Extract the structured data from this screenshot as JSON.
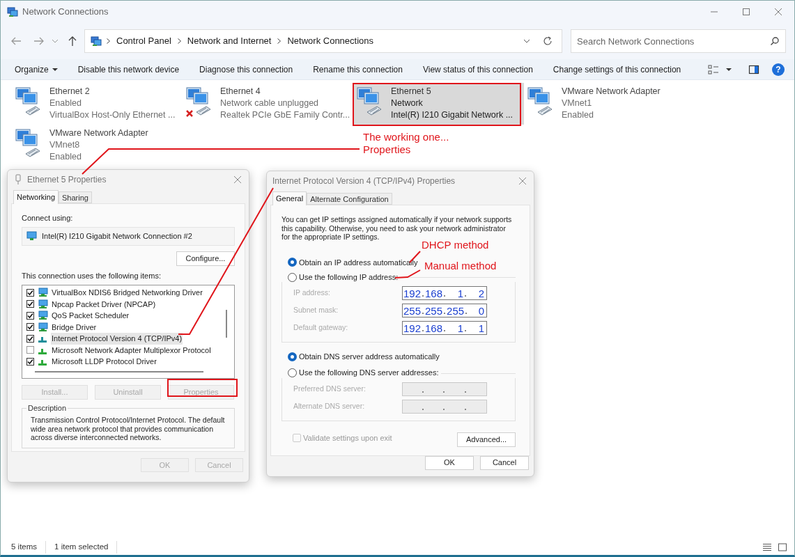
{
  "window": {
    "title": "Network Connections"
  },
  "address_bar": {
    "breadcrumbs": [
      "Control Panel",
      "Network and Internet",
      "Network Connections"
    ]
  },
  "search": {
    "placeholder": "Search Network Connections"
  },
  "command_bar": {
    "items": [
      {
        "label": "Organize",
        "kind": "menu"
      },
      {
        "label": "Disable this network device",
        "kind": "command"
      },
      {
        "label": "Diagnose this connection",
        "kind": "command"
      },
      {
        "label": "Rename this connection",
        "kind": "command"
      },
      {
        "label": "View status of this connection",
        "kind": "command"
      },
      {
        "label": "Change settings of this connection",
        "kind": "command"
      }
    ],
    "help_glyph": "?"
  },
  "adapters": [
    {
      "name": "Ethernet 2",
      "status": "Enabled",
      "device": "VirtualBox Host-Only Ethernet ...",
      "unplugged": false,
      "selected": false
    },
    {
      "name": "Ethernet 4",
      "status": "Network cable unplugged",
      "device": "Realtek PCIe GbE Family Contr...",
      "unplugged": true,
      "selected": false
    },
    {
      "name": "Ethernet 5",
      "status": "Network",
      "device": "Intel(R) I210 Gigabit Network ...",
      "unplugged": false,
      "selected": true
    },
    {
      "name": "VMware Network Adapter",
      "status": "VMnet1",
      "device": "Enabled",
      "unplugged": false,
      "selected": false
    },
    {
      "name": "VMware Network Adapter",
      "status": "VMnet8",
      "device": "Enabled",
      "unplugged": false,
      "selected": false
    }
  ],
  "status_bar": {
    "count": "5 items",
    "selection": "1 item selected"
  },
  "ethernet_dialog": {
    "title": "Ethernet 5 Properties",
    "tabs": [
      {
        "label": "Networking",
        "selected": true
      },
      {
        "label": "Sharing",
        "selected": false
      }
    ],
    "connect_using_label": "Connect using:",
    "device": "Intel(R) I210 Gigabit Network Connection #2",
    "configure_button": "Configure...",
    "items_label": "This connection uses the following items:",
    "items": [
      {
        "label": "VirtualBox NDIS6 Bridged Networking Driver",
        "kind": "service",
        "checked": true,
        "selected": false
      },
      {
        "label": "Npcap Packet Driver (NPCAP)",
        "kind": "service",
        "checked": true,
        "selected": false
      },
      {
        "label": "QoS Packet Scheduler",
        "kind": "service",
        "checked": true,
        "selected": false
      },
      {
        "label": "Bridge Driver",
        "kind": "service",
        "checked": true,
        "selected": false
      },
      {
        "label": "Internet Protocol Version 4 (TCP/IPv4)",
        "kind": "protocol",
        "checked": true,
        "selected": true
      },
      {
        "label": "Microsoft Network Adapter Multiplexor Protocol",
        "kind": "protocol",
        "checked": false,
        "selected": false
      },
      {
        "label": "Microsoft LLDP Protocol Driver",
        "kind": "protocol",
        "checked": true,
        "selected": false
      }
    ],
    "item_buttons": [
      {
        "label": "Install...",
        "disabled": true
      },
      {
        "label": "Uninstall",
        "disabled": true
      },
      {
        "label": "Properties",
        "disabled": true
      }
    ],
    "description_label": "Description",
    "description": "Transmission Control Protocol/Internet Protocol. The default wide area network protocol that provides communication across diverse interconnected networks.",
    "buttons": [
      {
        "label": "OK",
        "disabled": true
      },
      {
        "label": "Cancel",
        "disabled": true
      }
    ]
  },
  "ipv4_dialog": {
    "title": "Internet Protocol Version 4 (TCP/IPv4) Properties",
    "tabs": [
      {
        "label": "General",
        "selected": true
      },
      {
        "label": "Alternate Configuration",
        "selected": false
      }
    ],
    "intro": "You can get IP settings assigned automatically if your network supports this capability. Otherwise, you need to ask your network administrator for the appropriate IP settings.",
    "ip_options": [
      {
        "label": "Obtain an IP address automatically",
        "selected": true
      },
      {
        "label": "Use the following IP address:",
        "selected": false
      }
    ],
    "ip_fields": [
      {
        "label": "IP address:",
        "octets": [
          "192",
          "168",
          "1",
          "2"
        ]
      },
      {
        "label": "Subnet mask:",
        "octets": [
          "255",
          "255",
          "255",
          "0"
        ]
      },
      {
        "label": "Default gateway:",
        "octets": [
          "192",
          "168",
          "1",
          "1"
        ]
      }
    ],
    "ip_fields_disabled": true,
    "dns_options": [
      {
        "label": "Obtain DNS server address automatically",
        "selected": true
      },
      {
        "label": "Use the following DNS server addresses:",
        "selected": false
      }
    ],
    "dns_fields": [
      {
        "label": "Preferred DNS server:"
      },
      {
        "label": "Alternate DNS server:"
      }
    ],
    "dns_fields_disabled": true,
    "validate": {
      "label": "Validate settings upon exit",
      "checked": false,
      "disabled": true
    },
    "advanced_button": "Advanced...",
    "buttons": [
      {
        "label": "OK"
      },
      {
        "label": "Cancel"
      }
    ]
  },
  "annotations": {
    "adapter_note": [
      "The working one...",
      "Properties"
    ],
    "dhcp_note": "DHCP method",
    "manual_note": "Manual method"
  }
}
